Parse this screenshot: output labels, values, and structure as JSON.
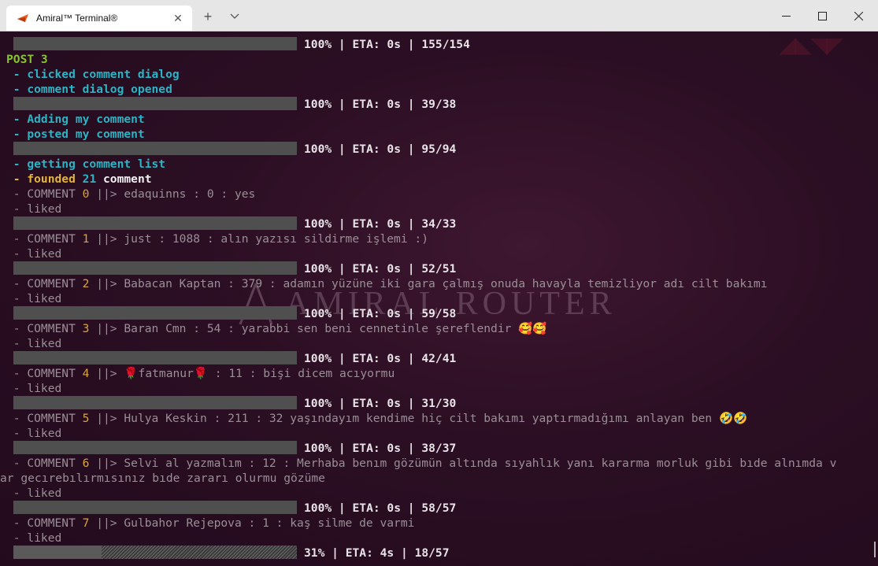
{
  "window": {
    "tab_title": "Amiral™ Terminal®",
    "tab_close": "✕",
    "new_tab": "+",
    "dropdown": "⌄",
    "minimize": "—",
    "maximize": "☐",
    "close": "✕"
  },
  "watermark": {
    "text": "AMIRAL ROUTER"
  },
  "terminal": {
    "l1": {
      "progress": "100% | ETA: 0s | 155/154"
    },
    "l2": {
      "text": "POST 3"
    },
    "l3": {
      "text": " - clicked comment dialog"
    },
    "l4": {
      "text": " - comment dialog opened"
    },
    "l5": {
      "progress": "100% | ETA: 0s | 39/38"
    },
    "l6": {
      "text": " - Adding my comment"
    },
    "l7": {
      "text": " - posted my comment"
    },
    "l8": {
      "progress": "100% | ETA: 0s | 95/94"
    },
    "l9": {
      "text": " - getting comment list"
    },
    "l10": {
      "prefix": " - founded ",
      "count": "21",
      "suffix": " comment"
    },
    "c0": {
      "head": " - COMMENT ",
      "n": "0",
      "sep": " ||> ",
      "rest": "edaquinns : 0 : yes"
    },
    "liked": " - liked",
    "p0": {
      "progress": "100% | ETA: 0s | 34/33"
    },
    "c1": {
      "head": " - COMMENT ",
      "n": "1",
      "sep": " ||> ",
      "rest": "just : 1088 : alın yazısı sildirme işlemi :)"
    },
    "p1": {
      "progress": "100% | ETA: 0s | 52/51"
    },
    "c2": {
      "head": " - COMMENT ",
      "n": "2",
      "sep": " ||> ",
      "rest": "Babacan Kaptan : 379 : adamın yüzüne iki gara çalmış onuda havayla temizliyor adı cilt bakımı"
    },
    "p2": {
      "progress": "100% | ETA: 0s | 59/58"
    },
    "c3": {
      "head": " - COMMENT ",
      "n": "3",
      "sep": " ||> ",
      "rest": "Baran Cmn : 54 : yarabbi sen beni cennetinle şereflendir 🥰🥰"
    },
    "p3": {
      "progress": "100% | ETA: 0s | 42/41"
    },
    "c4": {
      "head": " - COMMENT ",
      "n": "4",
      "sep": " ||> ",
      "rest": "🌹fatmanur🌹 : 11 : bişi dicem acıyormu"
    },
    "p4": {
      "progress": "100% | ETA: 0s | 31/30"
    },
    "c5": {
      "head": " - COMMENT ",
      "n": "5",
      "sep": " ||> ",
      "rest": "Hulya Keskin : 211 : 32 yaşındayım kendime hiç cilt bakımı yaptırmadığımı anlayan ben 🤣🤣"
    },
    "p5": {
      "progress": "100% | ETA: 0s | 38/37"
    },
    "c6": {
      "head": " - COMMENT ",
      "n": "6",
      "sep": " ||> ",
      "rest": "Selvi al yazmalım : 12 : Merhaba benım gözümün altında sıyahlık yanı kararma morluk gibi bıde alnımda v"
    },
    "c6b": {
      "text": "ar gecırebılırmısınız bıde zararı olurmu gözüme"
    },
    "p6": {
      "progress": "100% | ETA: 0s | 58/57"
    },
    "c7": {
      "head": " - COMMENT ",
      "n": "7",
      "sep": " ||> ",
      "rest": "Gulbahor Rejepova : 1 : kaş silme de varmi"
    },
    "p7": {
      "progress": "31% | ETA: 4s | 18/57",
      "fraction": 0.31
    }
  }
}
